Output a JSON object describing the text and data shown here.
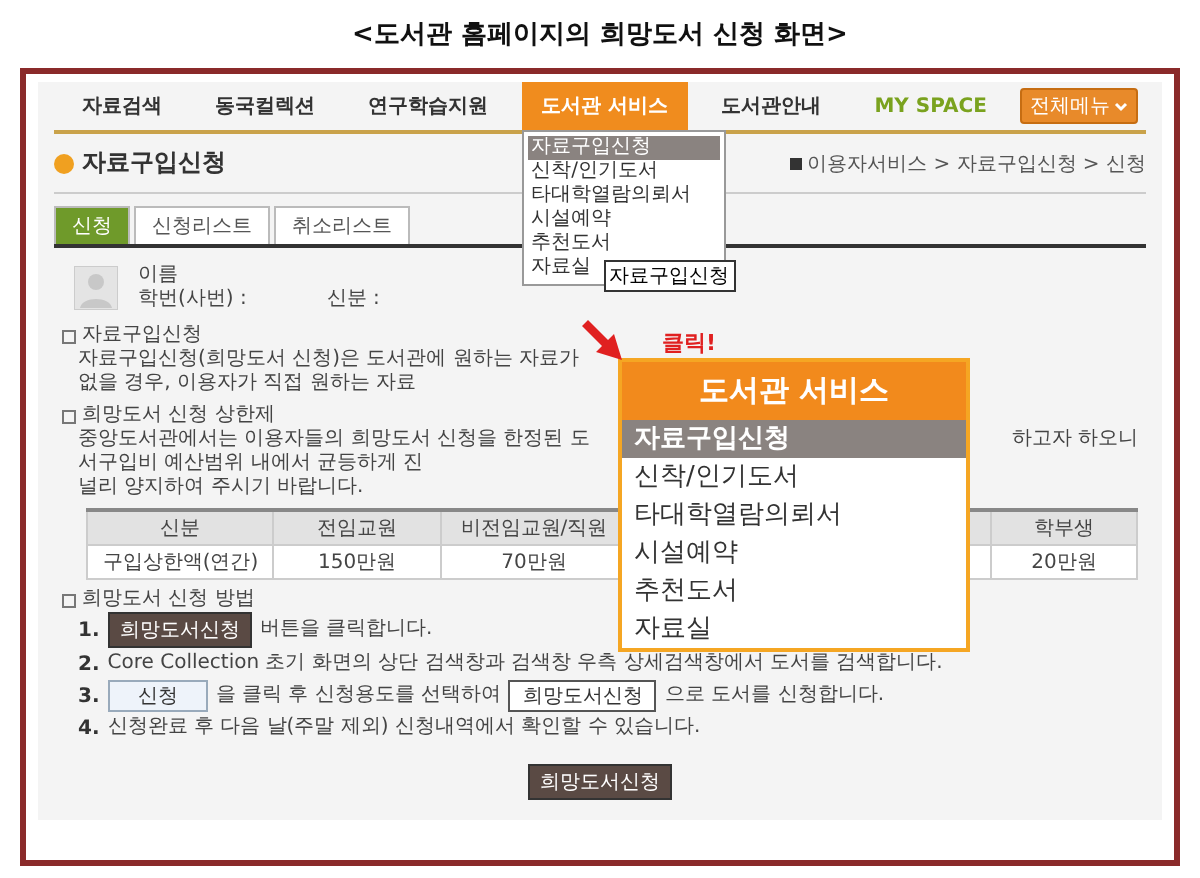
{
  "caption": "<도서관 홈페이지의 희망도서 신청 화면>",
  "nav": {
    "items": [
      {
        "label": "자료검색",
        "selected": false,
        "kind": "normal"
      },
      {
        "label": "동국컬렉션",
        "selected": false,
        "kind": "normal"
      },
      {
        "label": "연구학습지원",
        "selected": false,
        "kind": "normal"
      },
      {
        "label": "도서관 서비스",
        "selected": true,
        "kind": "normal"
      },
      {
        "label": "도서관안내",
        "selected": false,
        "kind": "normal"
      },
      {
        "label": "MY SPACE",
        "selected": false,
        "kind": "accent"
      }
    ],
    "all_menu_button": "전체메뉴",
    "dropdown": {
      "items": [
        {
          "label": "자료구입신청",
          "selected": true
        },
        {
          "label": "신착/인기도서",
          "selected": false
        },
        {
          "label": "타대학열람의뢰서",
          "selected": false
        },
        {
          "label": "시설예약",
          "selected": false
        },
        {
          "label": "추천도서",
          "selected": false
        },
        {
          "label": "자료실",
          "selected": false
        }
      ],
      "tooltip": "자료구입신청"
    }
  },
  "page_title": "자료구입신청",
  "breadcrumb": "이용자서비스 > 자료구입신청 > 신청",
  "tabs": [
    {
      "label": "신청",
      "selected": true
    },
    {
      "label": "신청리스트",
      "selected": false
    },
    {
      "label": "취소리스트",
      "selected": false
    }
  ],
  "user": {
    "name_label": "이름",
    "id_label": "학번(사번) :",
    "status_label": "신분 :"
  },
  "sections": [
    {
      "heading": "자료구입신청",
      "lines": [
        "자료구입신청(희망도서 신청)은 도서관에 원하는 자료가 없을 경우, 이용자가 직접 원하는 자료"
      ]
    },
    {
      "heading": "희망도서 신청 상한제",
      "lines": [
        "중앙도서관에서는 이용자들의 희망도서 신청을 한정된 도서구입비 예산범위 내에서 균등하게 진",
        "널리 양지하여 주시기 바랍니다."
      ],
      "right_fragment": "하고자 하오니"
    }
  ],
  "table": {
    "columns": [
      "신분",
      "전임교원",
      "비전임교원/직원",
      "",
      "학부생"
    ],
    "rows": [
      [
        "구입상한액(연간)",
        "150만원",
        "70만원",
        "",
        "20만원"
      ]
    ]
  },
  "method": {
    "heading": "희망도서 신청 방법",
    "steps": [
      {
        "kind": "button_first",
        "number": "1.",
        "button": "희망도서신청",
        "text": "버튼을 클릭합니다."
      },
      {
        "kind": "plain",
        "number": "2.",
        "text": "Core Collection 초기 화면의 상단 검색창과 검색창 우측 상세검색창에서 도서를 검색합니다."
      },
      {
        "kind": "two_buttons",
        "number": "3.",
        "button": "신청",
        "text": "을 클릭 후 신청용도를 선택하여",
        "button2": "희망도서신청",
        "text2": "으로 도서를 신청합니다."
      },
      {
        "kind": "plain",
        "number": "4.",
        "text": "신청완료 후 다음 날(주말 제외) 신청내역에서 확인할 수 있습니다."
      }
    ]
  },
  "submit_button": "희망도서신청",
  "callout": {
    "label": "클릭!",
    "title": "도서관 서비스",
    "items": [
      {
        "label": "자료구입신청",
        "selected": true
      },
      {
        "label": "신착/인기도서",
        "selected": false
      },
      {
        "label": "타대학열람의뢰서",
        "selected": false
      },
      {
        "label": "시설예약",
        "selected": false
      },
      {
        "label": "추천도서",
        "selected": false
      },
      {
        "label": "자료실",
        "selected": false
      }
    ]
  }
}
